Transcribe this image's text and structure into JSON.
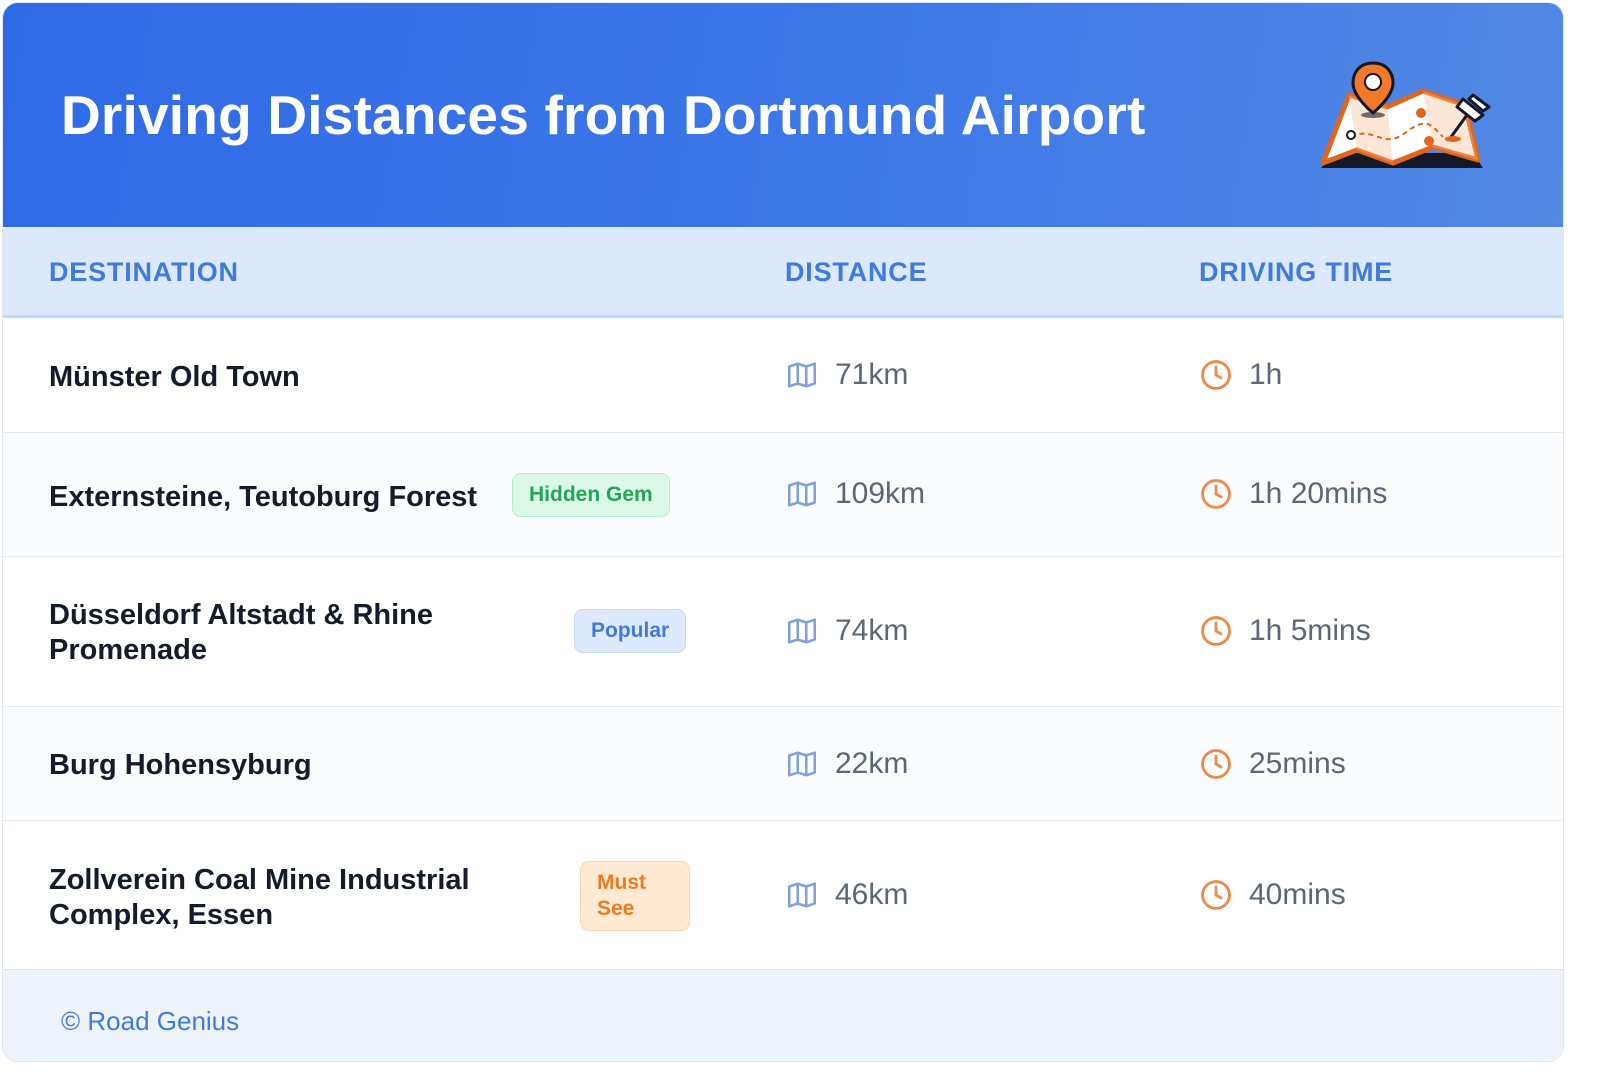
{
  "header": {
    "title": "Driving Distances from Dortmund Airport",
    "illustration_icon": "map-pin-illustration"
  },
  "columns": {
    "destination": "DESTINATION",
    "distance": "DISTANCE",
    "driving_time": "DRIVING TIME"
  },
  "rows": [
    {
      "destination": "Münster Old Town",
      "badge": "",
      "distance": "71km",
      "time": "1h"
    },
    {
      "destination": "Externsteine, Teutoburg Forest",
      "badge": "Hidden Gem",
      "badge_style": "green",
      "distance": "109km",
      "time": "1h 20mins"
    },
    {
      "destination": "Düsseldorf Altstadt & Rhine Promenade",
      "badge": "Popular",
      "badge_style": "blue",
      "distance": "74km",
      "time": "1h 5mins"
    },
    {
      "destination": "Burg Hohensyburg",
      "badge": "",
      "distance": "22km",
      "time": "25mins"
    },
    {
      "destination": "Zollverein Coal Mine Industrial Complex, Essen",
      "badge": "Must See",
      "badge_style": "orange",
      "distance": "46km",
      "time": "40mins"
    }
  ],
  "icons": {
    "distance": "map-icon",
    "time": "clock-icon"
  },
  "colors": {
    "accent": "#3f7ae0",
    "header_bg": "#2f6ae6",
    "clock": "#ee8a4a"
  },
  "footer": {
    "credit": "© Road Genius"
  }
}
